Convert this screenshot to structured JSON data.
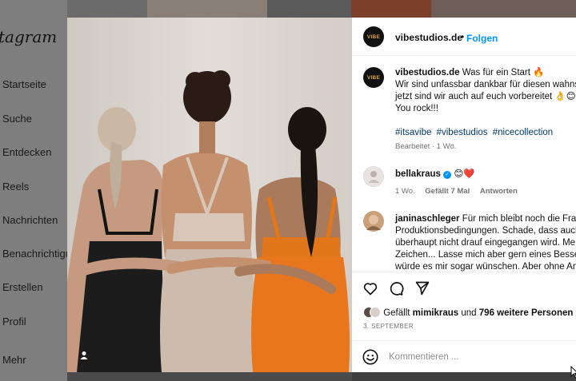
{
  "background": {
    "logo": "tagram",
    "nav": [
      "Startseite",
      "Suche",
      "Entdecken",
      "Reels",
      "Nachrichten",
      "Benachrichtigu",
      "Erstellen",
      "Profil",
      "Mehr"
    ]
  },
  "post": {
    "avatar_text": "VIBE",
    "username": "vibestudios.de",
    "separator": "•",
    "follow_label": "Folgen",
    "caption": {
      "username": "vibestudios.de",
      "line1": "Was für ein Start 🔥",
      "line2": "Wir sind unfassbar dankbar für diesen wahns",
      "line3": "jetzt sind wir auch auf euch vorbereitet 👌😊",
      "line4": "You rock!!!",
      "hashtags": [
        "#itsavibe",
        "#vibestudios",
        "#nicecollection"
      ],
      "meta": "Bearbeitet · 1 Wo."
    },
    "comments": [
      {
        "username": "bellakraus",
        "verified": "✓",
        "text": "😊❤️",
        "time": "1 Wo.",
        "likes": "Gefällt 7 Mal",
        "reply": "Antworten"
      },
      {
        "username": "janinaschleger",
        "line1": "Für mich bleibt noch die Frag",
        "line2": "Produktionsbedingungen. Schade, dass auch",
        "line3": "überhaupt nicht drauf eingegangen wird. Me",
        "line4": "Zeichen... Lasse mich aber gern eines Bessere",
        "line5": "würde es mir sogar wünschen. Aber ohne An"
      }
    ],
    "likes": {
      "prefix": "Gefällt",
      "user": "mimikraus",
      "and": "und",
      "others": "796 weitere Personen"
    },
    "date": "3. SEPTEMBER",
    "comment_placeholder": "Kommentieren ..."
  },
  "icons": {
    "like": "heart-icon",
    "comment": "comment-icon",
    "share": "share-icon",
    "emoji": "emoji-icon",
    "user_tag": "user-tag-icon"
  },
  "colors": {
    "link_blue": "#0095f6",
    "hashtag_blue": "#00376b",
    "meta_gray": "#737373",
    "brand_gold": "#d8a53c"
  }
}
